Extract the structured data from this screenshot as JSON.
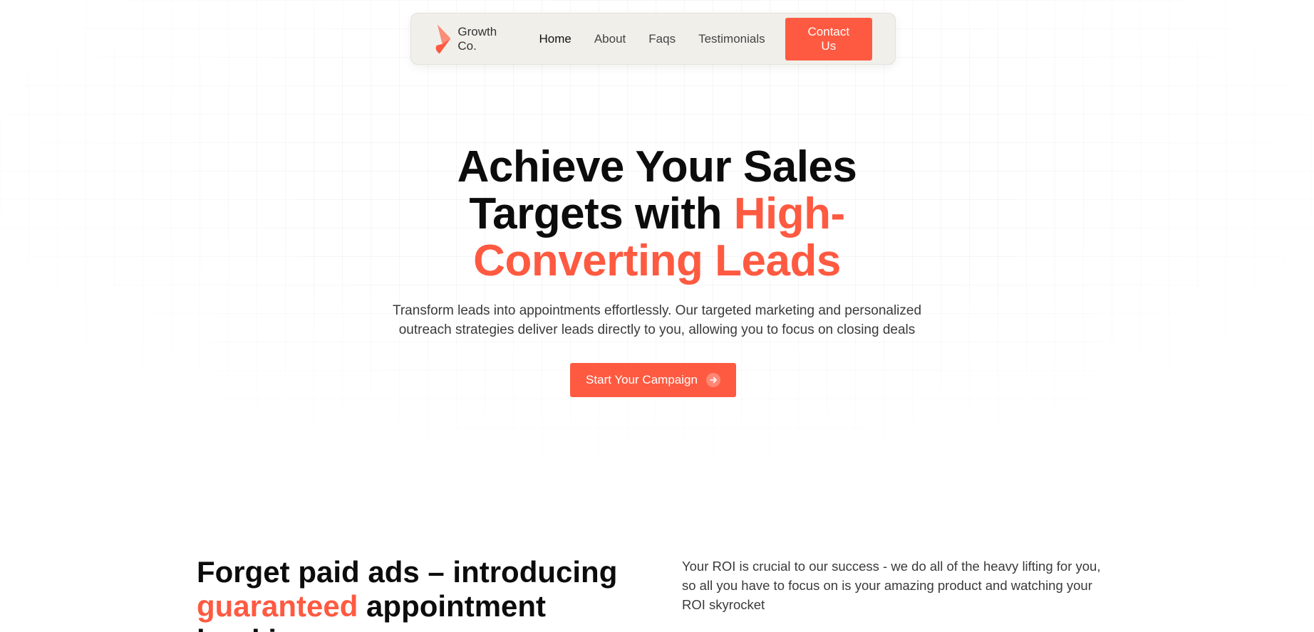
{
  "colors": {
    "accent": "#fe5a41",
    "nav_bg": "#f1efea"
  },
  "nav": {
    "logo_icon": "growth-logo-icon",
    "brand": "Growth Co.",
    "links": [
      {
        "label": "Home",
        "active": true
      },
      {
        "label": "About"
      },
      {
        "label": "Faqs"
      },
      {
        "label": "Testimonials"
      }
    ],
    "contact_label": "Contact Us"
  },
  "hero": {
    "title_part1": "Achieve Your Sales Targets with ",
    "title_accent": "High-Converting Leads",
    "subtitle": "Transform leads into appointments effortlessly. Our targeted marketing and personalized outreach strategies deliver leads directly to you, allowing you to focus on closing deals",
    "cta_label": "Start Your Campaign",
    "cta_icon": "arrow-right-circle-icon"
  },
  "section": {
    "title_part1": "Forget paid ads – introducing ",
    "title_accent": "guaranteed",
    "title_part2": " appointment booking",
    "body": "Your ROI is crucial to our success - we do all of the heavy lifting for you, so all you have to focus on is your amazing product and watching your ROI skyrocket"
  }
}
